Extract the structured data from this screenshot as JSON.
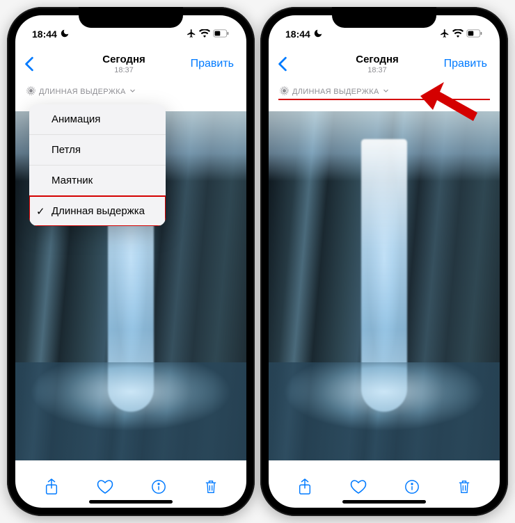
{
  "status": {
    "time": "18:44"
  },
  "nav": {
    "title": "Сегодня",
    "subtitle": "18:37",
    "edit": "Править"
  },
  "effect_label": "ДЛИННАЯ ВЫДЕРЖКА",
  "menu": {
    "items": [
      {
        "label": "Анимация"
      },
      {
        "label": "Петля"
      },
      {
        "label": "Маятник"
      },
      {
        "label": "Длинная выдержка",
        "selected": true
      }
    ]
  },
  "icons": {
    "moon": "moon-icon",
    "airplane": "airplane-icon",
    "wifi": "wifi-icon",
    "battery": "battery-icon",
    "back": "chevron-left-icon",
    "chevron_down": "chevron-down-icon",
    "live": "live-photo-icon",
    "share": "share-icon",
    "heart": "heart-icon",
    "info": "info-icon",
    "trash": "trash-icon"
  }
}
